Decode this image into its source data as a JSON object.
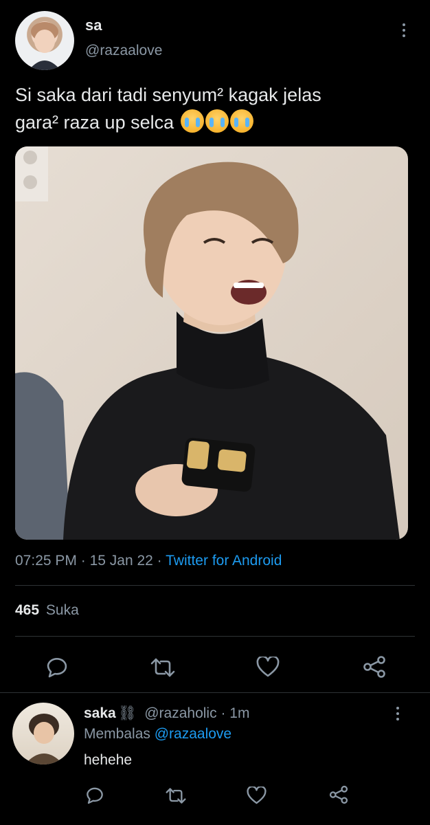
{
  "tweet": {
    "author_name": "sa",
    "author_handle": "@razaalove",
    "text_line1": "Si saka dari tadi senyum² kagak jelas",
    "text_line2": "gara² raza up selca",
    "emoji": "crying-face-emoji",
    "time": "07:25 PM",
    "date": "15 Jan 22",
    "source": "Twitter for Android",
    "sep": "·",
    "likes_count": "465",
    "likes_label": "Suka"
  },
  "reply": {
    "author_name": "saka",
    "author_badge": "⛓",
    "author_handle": "@razaholic",
    "time": "1m",
    "sep": "·",
    "replying_prefix": "Membalas",
    "replying_to": "@razaalove",
    "text": "hehehe"
  },
  "colors": {
    "background": "#000000",
    "text": "#e7e9ea",
    "muted": "#8b98a5",
    "accent": "#1d9bf0"
  }
}
